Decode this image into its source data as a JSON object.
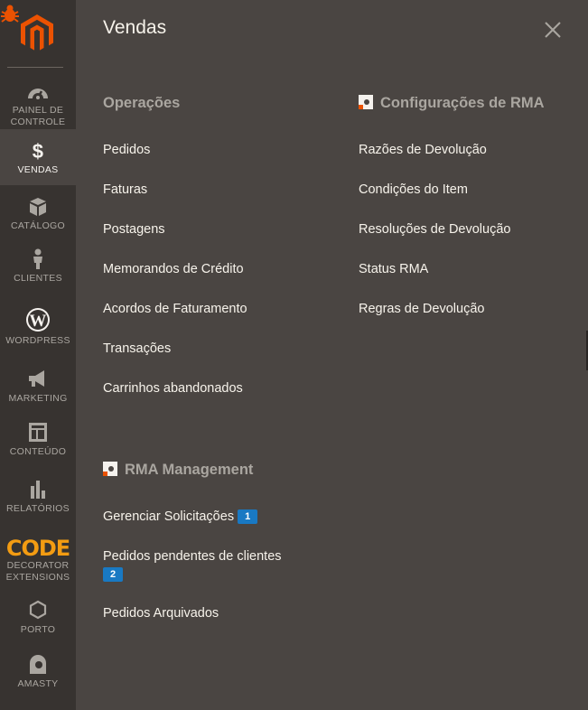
{
  "sidebar": {
    "items": [
      {
        "label_line1": "PAINEL DE",
        "label_line2": "CONTROLE"
      },
      {
        "label": "VENDAS"
      },
      {
        "label": "CATÁLOGO"
      },
      {
        "label": "CLIENTES"
      },
      {
        "label": "WORDPRESS"
      },
      {
        "label": "MARKETING"
      },
      {
        "label": "CONTEÚDO"
      },
      {
        "label": "RELATÓRIOS"
      },
      {
        "label_logo": "CODE",
        "label_line1": "DECORATOR",
        "label_line2": "EXTENSIONS"
      },
      {
        "label": "PORTO"
      },
      {
        "label": "AMASTY"
      }
    ]
  },
  "panel": {
    "title": "Vendas",
    "sections": {
      "operacoes": {
        "title": "Operações",
        "links": [
          "Pedidos",
          "Faturas",
          "Postagens",
          "Memorandos de Crédito",
          "Acordos de Faturamento",
          "Transações",
          "Carrinhos abandonados"
        ]
      },
      "rma_config": {
        "title": "Configurações de RMA",
        "links": [
          "Razões de Devolução",
          "Condições do Item",
          "Resoluções de Devolução",
          "Status RMA",
          "Regras de Devolução"
        ]
      },
      "rma_management": {
        "title": "RMA Management",
        "links": [
          {
            "label": "Gerenciar Solicitações",
            "badge": "1"
          },
          {
            "label": "Pedidos pendentes de clientes",
            "badge": "2"
          },
          {
            "label": "Pedidos Arquivados"
          }
        ]
      }
    }
  },
  "colors": {
    "sidebar_bg": "#373330",
    "panel_bg": "#4a4542",
    "brand_orange": "#eb5202",
    "badge_blue": "#1979c3"
  }
}
